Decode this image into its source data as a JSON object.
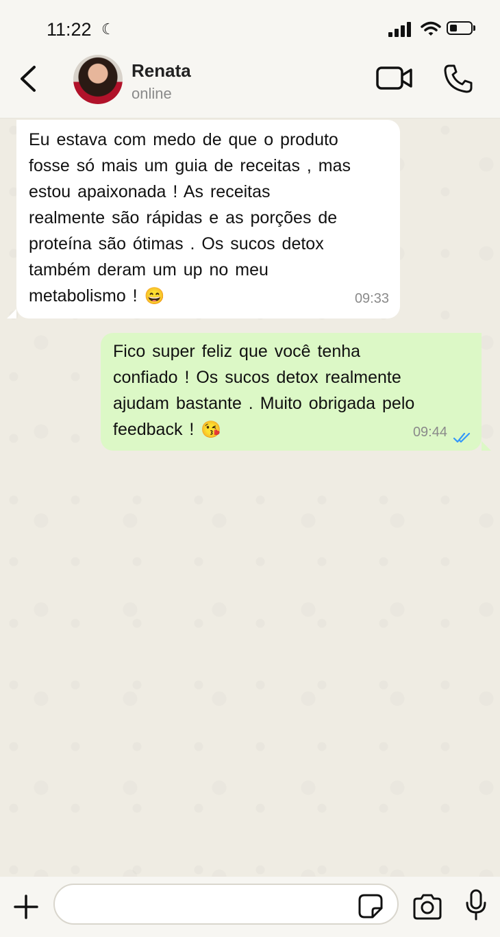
{
  "status_bar": {
    "time": "11:22",
    "focus_icon": "moon-icon",
    "signal_icon": "signal-icon",
    "wifi_icon": "wifi-icon",
    "battery_icon": "battery-icon",
    "battery_level": 0.25
  },
  "header": {
    "back_icon": "chevron-left-icon",
    "contact_name": "Renata",
    "contact_status": "online",
    "video_icon": "video-camera-icon",
    "call_icon": "phone-icon"
  },
  "messages": [
    {
      "direction": "incoming",
      "text": "Eu estava com  medo  de que  o produto\nfosse só mais um  guia de receitas , mas\nestou  apaixonada ! As receitas\nrealmente  são rápidas  e as porções  de\nproteína  são ótimas . Os sucos detox\ntambém  deram  um  up  no  meu\nmetabolismo  ! ",
      "emoji": "😄",
      "time": "09:33"
    },
    {
      "direction": "outgoing",
      "text": "Fico super  feliz que  você tenha\nconfiado ! Os sucos detox  realmente\najudam  bastante . Muito  obrigada  pelo\nfeedback ! ",
      "emoji": "😘",
      "time": "09:44",
      "status_icon": "double-check-icon",
      "status_color": "#3497f9"
    }
  ],
  "input_bar": {
    "plus_icon": "plus-icon",
    "placeholder": "",
    "sticker_icon": "sticker-icon",
    "camera_icon": "camera-icon",
    "mic_icon": "microphone-icon"
  }
}
